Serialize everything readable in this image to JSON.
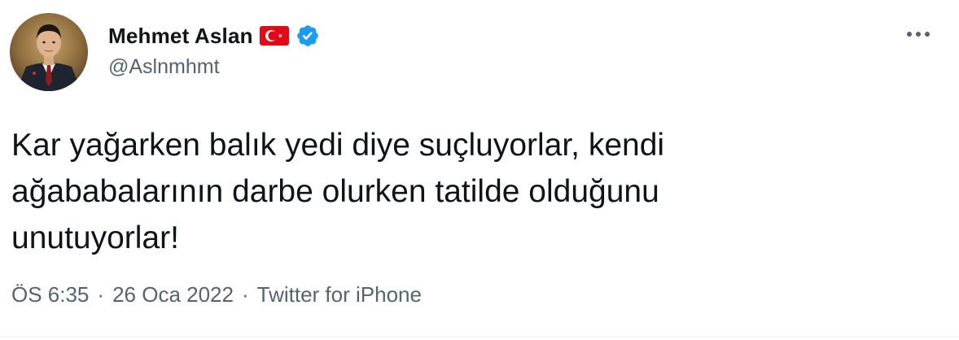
{
  "author": {
    "name": "Mehmet Aslan",
    "handle": "@Aslnmhmt",
    "flag_icon": "turkey-flag-icon",
    "verified_icon": "verified-badge-icon"
  },
  "menu": {
    "icon": "more-horizontal-icon"
  },
  "tweet": {
    "text": "Kar yağarken balık yedi diye suçluyorlar, kendi\nağababalarının darbe olurken tatilde olduğunu\nunutuyorlar!"
  },
  "meta": {
    "time": "ÖS 6:35",
    "date": "26 Oca 2022",
    "source": "Twitter for iPhone",
    "separator": "·"
  },
  "colors": {
    "text": "#0f1419",
    "secondary": "#536471",
    "verified": "#1d9bf0",
    "flag_red": "#e30a17"
  }
}
